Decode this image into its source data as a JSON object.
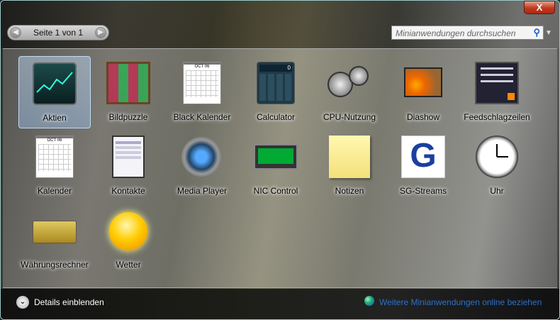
{
  "window": {
    "close_label": "X"
  },
  "pager": {
    "text": "Seite 1 von 1",
    "prev_icon": "chevron-left-icon",
    "next_icon": "chevron-right-icon"
  },
  "search": {
    "placeholder": "Minianwendungen durchsuchen",
    "icon": "search-icon"
  },
  "gadgets": [
    {
      "label": "Aktien",
      "selected": true
    },
    {
      "label": "Bildpuzzle"
    },
    {
      "label": "Black Kalender",
      "calendar_month": "OCT 06"
    },
    {
      "label": "Calculator",
      "display": "0"
    },
    {
      "label": "CPU-Nutzung"
    },
    {
      "label": "Diashow"
    },
    {
      "label": "Feedschlagzeilen"
    },
    {
      "label": "Kalender",
      "calendar_month": "OCT 06"
    },
    {
      "label": "Kontakte"
    },
    {
      "label": "Media Player"
    },
    {
      "label": "NIC Control"
    },
    {
      "label": "Notizen"
    },
    {
      "label": "SG-Streams"
    },
    {
      "label": "Uhr"
    },
    {
      "label": "Währungsrechner"
    },
    {
      "label": "Wetter"
    }
  ],
  "footer": {
    "details_label": "Details einblenden",
    "online_label": "Weitere Minianwendungen online beziehen"
  },
  "colors": {
    "selection": "#a9c8eb",
    "link": "#2f6fc8",
    "close": "#c0391f"
  }
}
